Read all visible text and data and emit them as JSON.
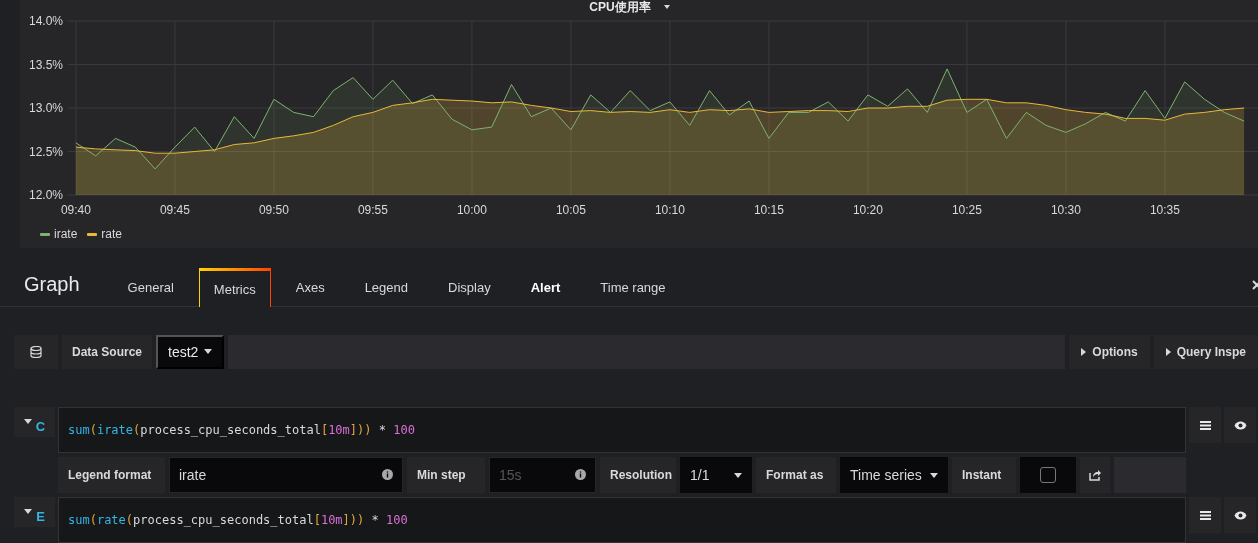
{
  "panel": {
    "chart_data": {
      "type": "area",
      "title": "CPU使用率",
      "categories": [
        "09:40",
        null,
        null,
        null,
        null,
        "09:45",
        null,
        null,
        null,
        null,
        "09:50",
        null,
        null,
        null,
        null,
        "09:55",
        null,
        null,
        null,
        null,
        "10:00",
        null,
        null,
        null,
        null,
        "10:05",
        null,
        null,
        null,
        null,
        "10:10",
        null,
        null,
        null,
        null,
        "10:15",
        null,
        null,
        null,
        null,
        "10:20",
        null,
        null,
        null,
        null,
        "10:25",
        null,
        null,
        null,
        null,
        "10:30",
        null,
        null,
        null,
        null,
        "10:35",
        null,
        null,
        null,
        null
      ],
      "series": [
        {
          "name": "irate",
          "color": "#7eb26d",
          "values": [
            12.6,
            12.45,
            12.65,
            12.55,
            12.3,
            12.55,
            12.78,
            12.5,
            12.9,
            12.65,
            13.1,
            12.95,
            12.9,
            13.2,
            13.35,
            13.1,
            13.32,
            13.05,
            13.15,
            12.87,
            12.75,
            12.78,
            13.27,
            12.9,
            13.0,
            12.75,
            13.15,
            12.95,
            13.2,
            12.97,
            13.07,
            12.8,
            13.2,
            12.92,
            13.08,
            12.65,
            12.95,
            12.95,
            13.07,
            12.85,
            13.15,
            13.02,
            13.22,
            12.95,
            13.45,
            12.95,
            13.1,
            12.65,
            12.95,
            12.8,
            12.72,
            12.82,
            12.95,
            12.85,
            13.2,
            12.88,
            13.3,
            13.1,
            12.95,
            12.85
          ]
        },
        {
          "name": "rate",
          "color": "#eab839",
          "values": [
            12.55,
            12.53,
            12.52,
            12.51,
            12.48,
            12.48,
            12.5,
            12.52,
            12.58,
            12.6,
            12.65,
            12.68,
            12.72,
            12.8,
            12.9,
            12.95,
            13.03,
            13.06,
            13.1,
            13.09,
            13.08,
            13.06,
            13.07,
            13.03,
            13.0,
            12.96,
            12.97,
            12.95,
            12.96,
            12.95,
            12.98,
            12.95,
            12.98,
            12.97,
            12.99,
            12.95,
            12.96,
            12.97,
            12.97,
            12.96,
            13.0,
            13.0,
            13.02,
            13.02,
            13.09,
            13.1,
            13.1,
            13.06,
            13.06,
            13.03,
            12.98,
            12.95,
            12.93,
            12.88,
            12.88,
            12.86,
            12.93,
            12.95,
            12.98,
            13.0
          ]
        }
      ],
      "ylim": [
        12.0,
        14.0
      ],
      "grid": true,
      "yticks": [
        {
          "value": 12.0,
          "label": "12.0%"
        },
        {
          "value": 12.5,
          "label": "12.5%"
        },
        {
          "value": 13.0,
          "label": "13.0%"
        },
        {
          "value": 13.5,
          "label": "13.5%"
        },
        {
          "value": 14.0,
          "label": "14.0%"
        }
      ]
    }
  },
  "editor": {
    "title": "Graph",
    "tabs": [
      {
        "label": "General",
        "selected": false,
        "emphasis": false
      },
      {
        "label": "Metrics",
        "selected": true,
        "emphasis": false
      },
      {
        "label": "Axes",
        "selected": false,
        "emphasis": false
      },
      {
        "label": "Legend",
        "selected": false,
        "emphasis": false
      },
      {
        "label": "Display",
        "selected": false,
        "emphasis": false
      },
      {
        "label": "Alert",
        "selected": false,
        "emphasis": true
      },
      {
        "label": "Time range",
        "selected": false,
        "emphasis": false
      }
    ]
  },
  "data_source": {
    "label": "Data Source",
    "value": "test2"
  },
  "toolbar_buttons": [
    "Options",
    "Query Inspe"
  ],
  "queries": [
    {
      "letter": "C",
      "expression": "sum(irate(process_cpu_seconds_total[10m])) * 100",
      "options": {
        "legend_format": {
          "label": "Legend format",
          "value": "irate"
        },
        "min_step": {
          "label": "Min step",
          "placeholder": "15s"
        },
        "resolution": {
          "label": "Resolution",
          "value": "1/1"
        },
        "format_as": {
          "label": "Format as",
          "value": "Time series"
        },
        "instant": {
          "label": "Instant",
          "checked": false
        }
      }
    },
    {
      "letter": "E",
      "expression": "sum(rate(process_cpu_seconds_total[10m])) * 100"
    }
  ]
}
